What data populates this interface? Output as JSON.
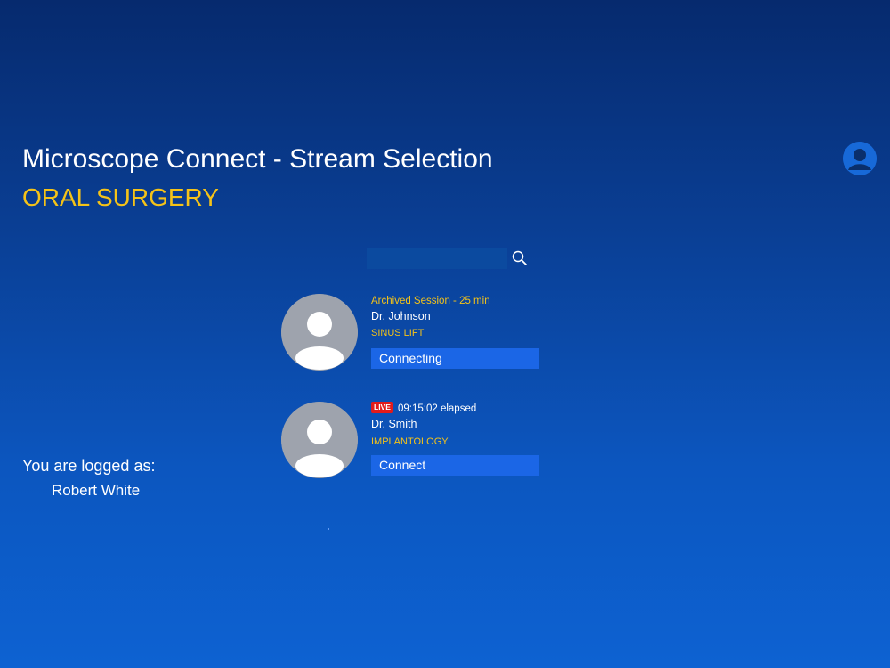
{
  "header": {
    "title": "Microscope Connect - Stream Selection",
    "subtitle": "ORAL SURGERY",
    "profile_icon": "user-profile-icon"
  },
  "search": {
    "value": "",
    "placeholder": "",
    "icon": "search-icon"
  },
  "streams": [
    {
      "status": "Archived Session - 25 min",
      "doctor": "Dr. Johnson",
      "procedure": "SINUS LIFT",
      "button_label": "Connecting",
      "live": false
    },
    {
      "badge": "LIVE",
      "status": "09:15:02 elapsed",
      "doctor": "Dr. Smith",
      "procedure": "IMPLANTOLOGY",
      "button_label": "Connect",
      "live": true
    }
  ],
  "session": {
    "logged_label": "You are logged as:",
    "user_name": "Robert White"
  },
  "colors": {
    "accent_yellow": "#f5c318",
    "button_blue": "#1b66e6",
    "live_red": "#e21b1b",
    "background_top": "#062a6e",
    "background_bottom": "#0d62d2"
  }
}
